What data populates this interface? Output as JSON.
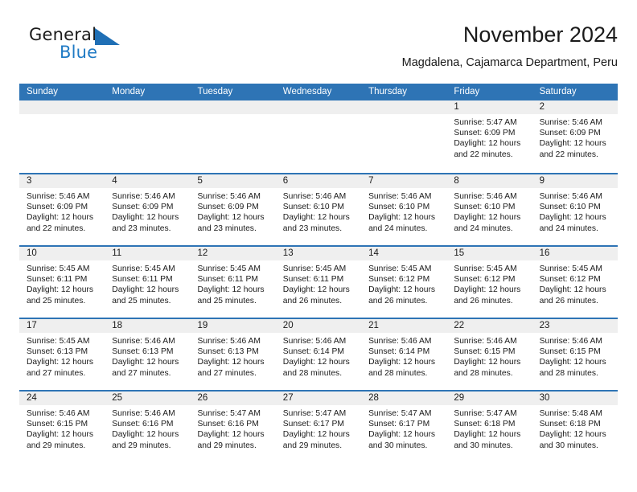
{
  "brand": {
    "name_part1": "General",
    "name_part2": "Blue",
    "accent_color": "#1f7ac4"
  },
  "header": {
    "title": "November 2024",
    "subtitle": "Magdalena, Cajamarca Department, Peru"
  },
  "theme": {
    "header_blue": "#2e74b5",
    "date_band_gray": "#efefef",
    "text": "#1a1a1a"
  },
  "calendar": {
    "weekday_headers": [
      "Sunday",
      "Monday",
      "Tuesday",
      "Wednesday",
      "Thursday",
      "Friday",
      "Saturday"
    ],
    "weeks": [
      [
        {
          "date": "",
          "empty": true
        },
        {
          "date": "",
          "empty": true
        },
        {
          "date": "",
          "empty": true
        },
        {
          "date": "",
          "empty": true
        },
        {
          "date": "",
          "empty": true
        },
        {
          "date": "1",
          "sunrise": "Sunrise: 5:47 AM",
          "sunset": "Sunset: 6:09 PM",
          "daylight_line1": "Daylight: 12 hours",
          "daylight_line2": "and 22 minutes."
        },
        {
          "date": "2",
          "sunrise": "Sunrise: 5:46 AM",
          "sunset": "Sunset: 6:09 PM",
          "daylight_line1": "Daylight: 12 hours",
          "daylight_line2": "and 22 minutes."
        }
      ],
      [
        {
          "date": "3",
          "sunrise": "Sunrise: 5:46 AM",
          "sunset": "Sunset: 6:09 PM",
          "daylight_line1": "Daylight: 12 hours",
          "daylight_line2": "and 22 minutes."
        },
        {
          "date": "4",
          "sunrise": "Sunrise: 5:46 AM",
          "sunset": "Sunset: 6:09 PM",
          "daylight_line1": "Daylight: 12 hours",
          "daylight_line2": "and 23 minutes."
        },
        {
          "date": "5",
          "sunrise": "Sunrise: 5:46 AM",
          "sunset": "Sunset: 6:09 PM",
          "daylight_line1": "Daylight: 12 hours",
          "daylight_line2": "and 23 minutes."
        },
        {
          "date": "6",
          "sunrise": "Sunrise: 5:46 AM",
          "sunset": "Sunset: 6:10 PM",
          "daylight_line1": "Daylight: 12 hours",
          "daylight_line2": "and 23 minutes."
        },
        {
          "date": "7",
          "sunrise": "Sunrise: 5:46 AM",
          "sunset": "Sunset: 6:10 PM",
          "daylight_line1": "Daylight: 12 hours",
          "daylight_line2": "and 24 minutes."
        },
        {
          "date": "8",
          "sunrise": "Sunrise: 5:46 AM",
          "sunset": "Sunset: 6:10 PM",
          "daylight_line1": "Daylight: 12 hours",
          "daylight_line2": "and 24 minutes."
        },
        {
          "date": "9",
          "sunrise": "Sunrise: 5:46 AM",
          "sunset": "Sunset: 6:10 PM",
          "daylight_line1": "Daylight: 12 hours",
          "daylight_line2": "and 24 minutes."
        }
      ],
      [
        {
          "date": "10",
          "sunrise": "Sunrise: 5:45 AM",
          "sunset": "Sunset: 6:11 PM",
          "daylight_line1": "Daylight: 12 hours",
          "daylight_line2": "and 25 minutes."
        },
        {
          "date": "11",
          "sunrise": "Sunrise: 5:45 AM",
          "sunset": "Sunset: 6:11 PM",
          "daylight_line1": "Daylight: 12 hours",
          "daylight_line2": "and 25 minutes."
        },
        {
          "date": "12",
          "sunrise": "Sunrise: 5:45 AM",
          "sunset": "Sunset: 6:11 PM",
          "daylight_line1": "Daylight: 12 hours",
          "daylight_line2": "and 25 minutes."
        },
        {
          "date": "13",
          "sunrise": "Sunrise: 5:45 AM",
          "sunset": "Sunset: 6:11 PM",
          "daylight_line1": "Daylight: 12 hours",
          "daylight_line2": "and 26 minutes."
        },
        {
          "date": "14",
          "sunrise": "Sunrise: 5:45 AM",
          "sunset": "Sunset: 6:12 PM",
          "daylight_line1": "Daylight: 12 hours",
          "daylight_line2": "and 26 minutes."
        },
        {
          "date": "15",
          "sunrise": "Sunrise: 5:45 AM",
          "sunset": "Sunset: 6:12 PM",
          "daylight_line1": "Daylight: 12 hours",
          "daylight_line2": "and 26 minutes."
        },
        {
          "date": "16",
          "sunrise": "Sunrise: 5:45 AM",
          "sunset": "Sunset: 6:12 PM",
          "daylight_line1": "Daylight: 12 hours",
          "daylight_line2": "and 26 minutes."
        }
      ],
      [
        {
          "date": "17",
          "sunrise": "Sunrise: 5:45 AM",
          "sunset": "Sunset: 6:13 PM",
          "daylight_line1": "Daylight: 12 hours",
          "daylight_line2": "and 27 minutes."
        },
        {
          "date": "18",
          "sunrise": "Sunrise: 5:46 AM",
          "sunset": "Sunset: 6:13 PM",
          "daylight_line1": "Daylight: 12 hours",
          "daylight_line2": "and 27 minutes."
        },
        {
          "date": "19",
          "sunrise": "Sunrise: 5:46 AM",
          "sunset": "Sunset: 6:13 PM",
          "daylight_line1": "Daylight: 12 hours",
          "daylight_line2": "and 27 minutes."
        },
        {
          "date": "20",
          "sunrise": "Sunrise: 5:46 AM",
          "sunset": "Sunset: 6:14 PM",
          "daylight_line1": "Daylight: 12 hours",
          "daylight_line2": "and 28 minutes."
        },
        {
          "date": "21",
          "sunrise": "Sunrise: 5:46 AM",
          "sunset": "Sunset: 6:14 PM",
          "daylight_line1": "Daylight: 12 hours",
          "daylight_line2": "and 28 minutes."
        },
        {
          "date": "22",
          "sunrise": "Sunrise: 5:46 AM",
          "sunset": "Sunset: 6:15 PM",
          "daylight_line1": "Daylight: 12 hours",
          "daylight_line2": "and 28 minutes."
        },
        {
          "date": "23",
          "sunrise": "Sunrise: 5:46 AM",
          "sunset": "Sunset: 6:15 PM",
          "daylight_line1": "Daylight: 12 hours",
          "daylight_line2": "and 28 minutes."
        }
      ],
      [
        {
          "date": "24",
          "sunrise": "Sunrise: 5:46 AM",
          "sunset": "Sunset: 6:15 PM",
          "daylight_line1": "Daylight: 12 hours",
          "daylight_line2": "and 29 minutes."
        },
        {
          "date": "25",
          "sunrise": "Sunrise: 5:46 AM",
          "sunset": "Sunset: 6:16 PM",
          "daylight_line1": "Daylight: 12 hours",
          "daylight_line2": "and 29 minutes."
        },
        {
          "date": "26",
          "sunrise": "Sunrise: 5:47 AM",
          "sunset": "Sunset: 6:16 PM",
          "daylight_line1": "Daylight: 12 hours",
          "daylight_line2": "and 29 minutes."
        },
        {
          "date": "27",
          "sunrise": "Sunrise: 5:47 AM",
          "sunset": "Sunset: 6:17 PM",
          "daylight_line1": "Daylight: 12 hours",
          "daylight_line2": "and 29 minutes."
        },
        {
          "date": "28",
          "sunrise": "Sunrise: 5:47 AM",
          "sunset": "Sunset: 6:17 PM",
          "daylight_line1": "Daylight: 12 hours",
          "daylight_line2": "and 30 minutes."
        },
        {
          "date": "29",
          "sunrise": "Sunrise: 5:47 AM",
          "sunset": "Sunset: 6:18 PM",
          "daylight_line1": "Daylight: 12 hours",
          "daylight_line2": "and 30 minutes."
        },
        {
          "date": "30",
          "sunrise": "Sunrise: 5:48 AM",
          "sunset": "Sunset: 6:18 PM",
          "daylight_line1": "Daylight: 12 hours",
          "daylight_line2": "and 30 minutes."
        }
      ]
    ]
  }
}
